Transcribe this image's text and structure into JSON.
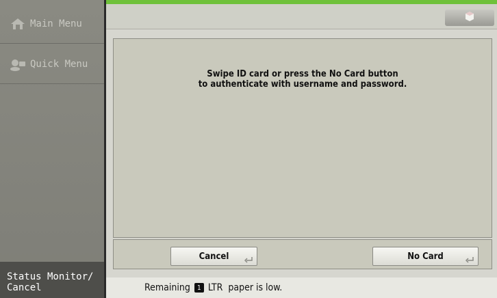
{
  "sidebar": {
    "main_menu": "Main Menu",
    "quick_menu": "Quick Menu",
    "status_monitor_line1": "Status Monitor/",
    "status_monitor_line2": "Cancel"
  },
  "dialog": {
    "message_line1": "Swipe ID card or press the No Card button",
    "message_line2": "to authenticate with username and password."
  },
  "buttons": {
    "cancel": "Cancel",
    "no_card": "No Card"
  },
  "status": {
    "prefix": "Remaining",
    "tray_number": "1",
    "suffix": "LTR  paper is low."
  },
  "colors": {
    "background_accent": "#6fc13a",
    "sidebar": "#8a8a82",
    "content": "#d6d6cf"
  },
  "icons": {
    "main_menu": "home-icon",
    "quick_menu": "quick-menu-icon",
    "top_right": "cube-icon"
  }
}
